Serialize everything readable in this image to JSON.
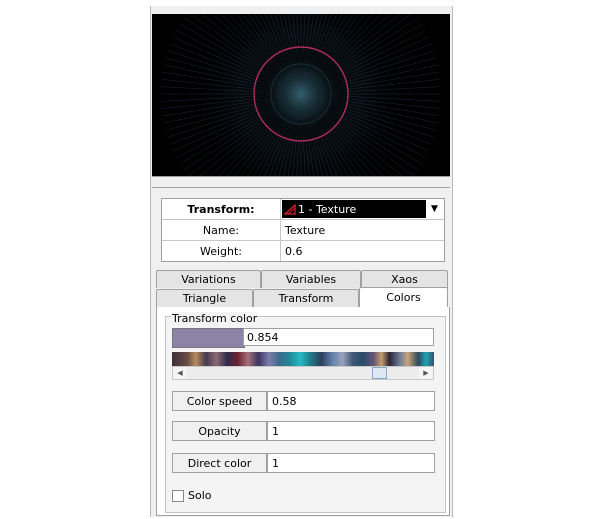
{
  "grid": {
    "transform_label": "Transform:",
    "transform_value": "1 - Texture",
    "name_label": "Name:",
    "name_value": "Texture",
    "weight_label": "Weight:",
    "weight_value": "0.6"
  },
  "tabs": {
    "row1": [
      "Variations",
      "Variables",
      "Xaos"
    ],
    "row2": [
      "Triangle",
      "Transform",
      "Colors"
    ],
    "active": "Colors"
  },
  "colors": {
    "group_title": "Transform color",
    "color_value": "0.854",
    "swatch_color": "#8d83a7",
    "color_speed_label": "Color speed",
    "color_speed_value": "0.58",
    "opacity_label": "Opacity",
    "opacity_value": "1",
    "direct_color_label": "Direct color",
    "direct_color_value": "1",
    "solo_label": "Solo",
    "solo_checked": false
  }
}
